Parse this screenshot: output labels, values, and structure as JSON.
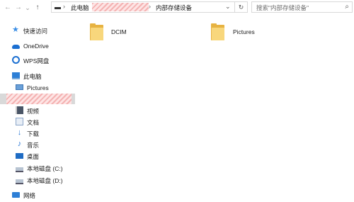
{
  "address_bar": {
    "back": "←",
    "forward": "→",
    "recent": "⌄",
    "up": "↑",
    "crumbs": [
      "此电脑",
      "内部存储设备"
    ],
    "dropdown": "⌄",
    "refresh": "↻"
  },
  "search": {
    "placeholder": "搜索\"内部存储设备\"",
    "icon": "search-icon"
  },
  "nav": {
    "quick_access": "快速访问",
    "onedrive": "OneDrive",
    "wps": "WPS网盘",
    "this_pc": "此电脑",
    "pictures": "Pictures",
    "videos": "视频",
    "documents": "文档",
    "downloads": "下载",
    "music": "音乐",
    "desktop": "桌面",
    "drive_c": "本地磁盘 (C:)",
    "drive_d": "本地磁盘 (D:)",
    "network": "网络"
  },
  "content": {
    "folders": [
      {
        "name": "DCIM"
      },
      {
        "name": "Pictures"
      }
    ]
  },
  "colors": {
    "selection": "#d9d9d9",
    "folder": "#f8d77c",
    "accent": "#1b6fd1"
  }
}
